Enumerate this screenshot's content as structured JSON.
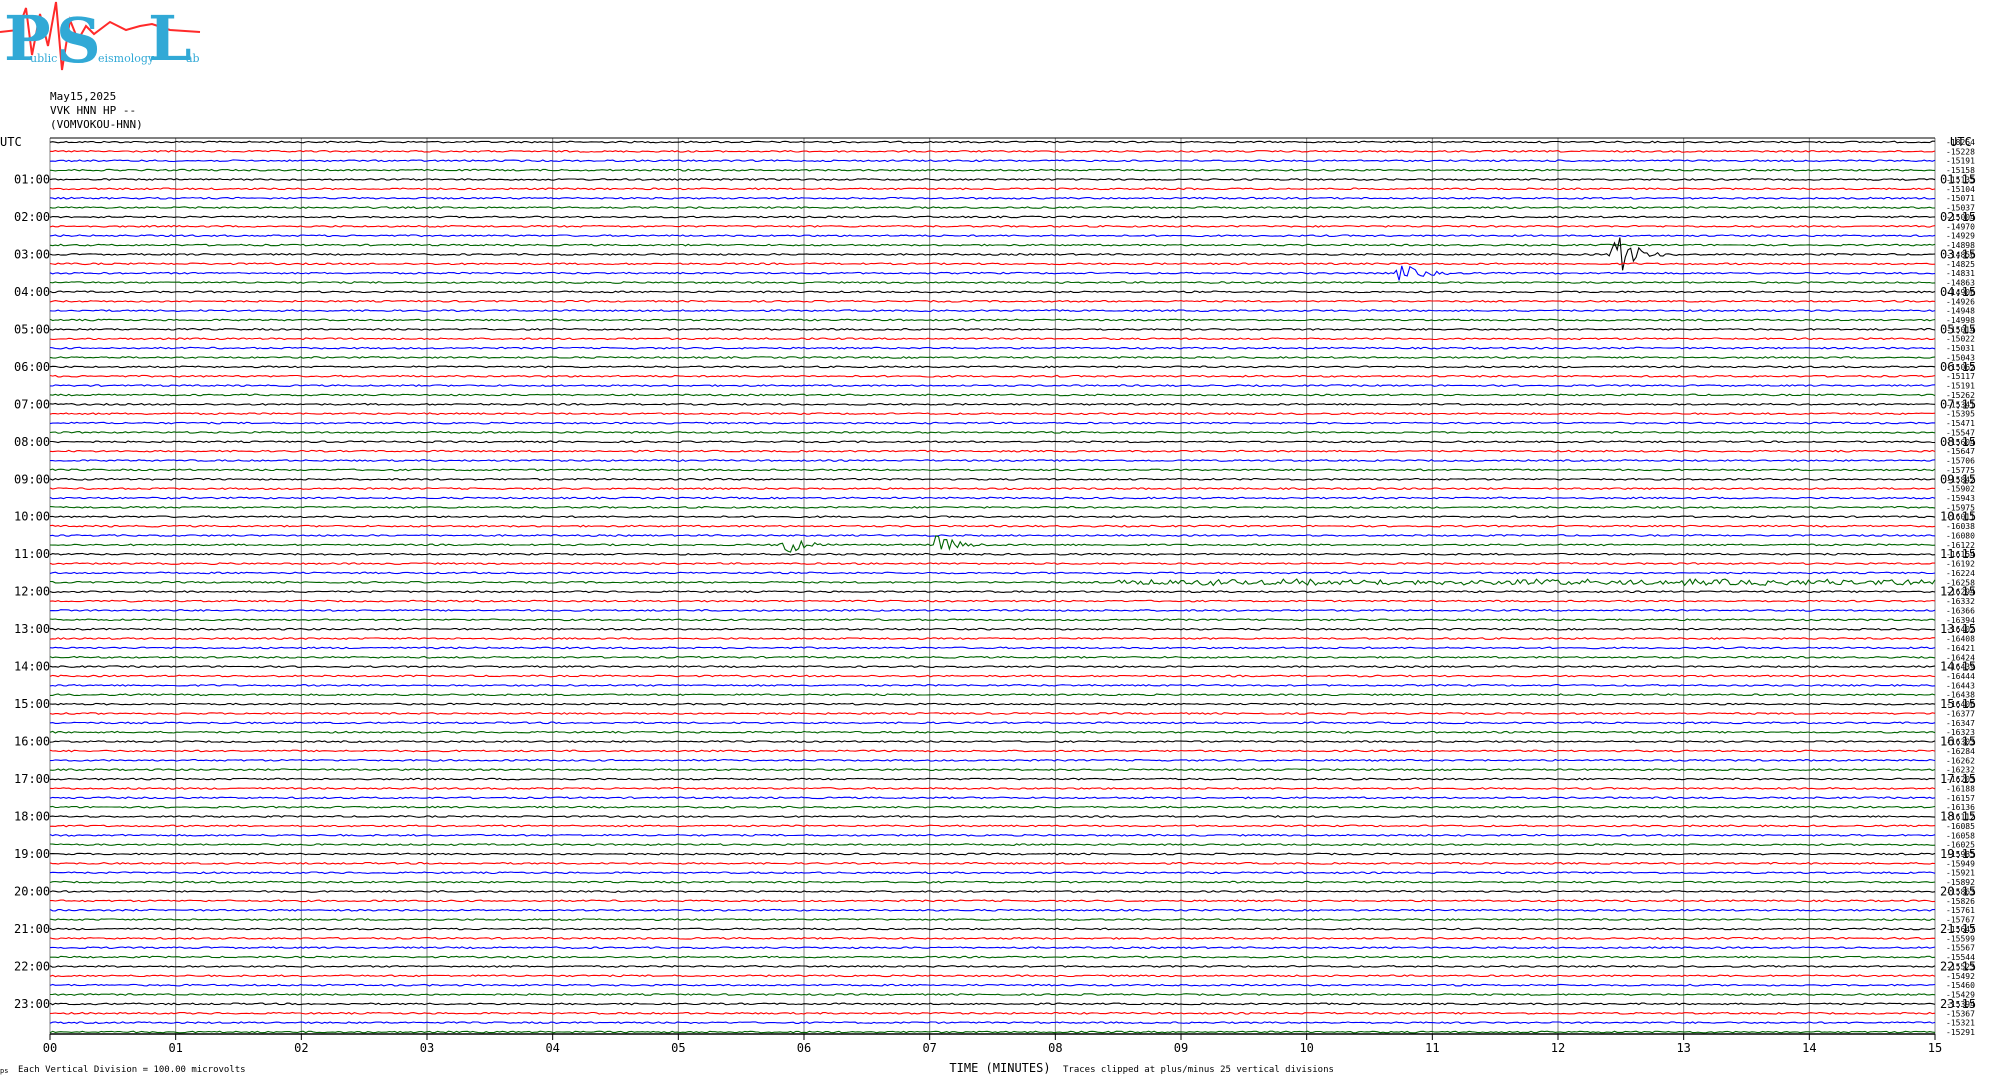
{
  "logo": {
    "letters": [
      "P",
      "S",
      "L"
    ],
    "tagline": [
      "ublic",
      "eismology",
      "ab"
    ]
  },
  "header": {
    "date": "May15,2025",
    "channel": "VVK HNN HP --",
    "station": "(VOMVOKOU-HNN)"
  },
  "left_axis_label": "UTC",
  "right_axis_label": "UTC",
  "footer": {
    "scale_note": "Each Vertical Division =  100.00 microvolts",
    "clip_note": "Traces clipped at plus/minus 25 vertical divisions",
    "corner_mark": "ps"
  },
  "colors": {
    "black": "#000000",
    "red": "#ff0000",
    "blue": "#0000ff",
    "green": "#006400",
    "grid": "#808080",
    "logo": "#31a9d6"
  },
  "chart_data": {
    "type": "line",
    "title": "May15,2025",
    "xlabel": "TIME (MINUTES)",
    "ylabel": "UTC",
    "xlim": [
      0,
      15
    ],
    "x_ticks": [
      "00",
      "01",
      "02",
      "03",
      "04",
      "05",
      "06",
      "07",
      "08",
      "09",
      "10",
      "11",
      "12",
      "13",
      "14",
      "15"
    ],
    "trace_minutes": 15,
    "trace_color_cycle": [
      "black",
      "red",
      "blue",
      "green"
    ],
    "left_hour_labels": [
      "01:00",
      "02:00",
      "03:00",
      "04:00",
      "05:00",
      "06:00",
      "07:00",
      "08:00",
      "09:00",
      "10:00",
      "11:00",
      "12:00",
      "13:00",
      "14:00",
      "15:00",
      "16:00",
      "17:00",
      "18:00",
      "19:00",
      "20:00",
      "21:00",
      "22:00",
      "23:00"
    ],
    "right_hour_labels": [
      "01:15",
      "02:15",
      "03:15",
      "04:15",
      "05:15",
      "06:15",
      "07:15",
      "08:15",
      "09:15",
      "10:15",
      "11:15",
      "12:15",
      "13:15",
      "14:15",
      "15:15",
      "16:15",
      "17:15",
      "18:15",
      "19:15",
      "20:15",
      "21:15",
      "22:15",
      "23:15"
    ],
    "right_offsets": [
      "-18264",
      "-15228",
      "-15191",
      "-15158",
      "-15135",
      "-15104",
      "-15071",
      "-15037",
      "-15004",
      "-14970",
      "-14929",
      "-14898",
      "-14856",
      "-14825",
      "-14831",
      "-14863",
      "-14906",
      "-14926",
      "-14948",
      "-14998",
      "-15014",
      "-15022",
      "-15031",
      "-15043",
      "-15062",
      "-15117",
      "-15191",
      "-15262",
      "-15341",
      "-15395",
      "-15471",
      "-15547",
      "-15604",
      "-15647",
      "-15706",
      "-15775",
      "-15842",
      "-15902",
      "-15943",
      "-15975",
      "-16011",
      "-16038",
      "-16080",
      "-16122",
      "-16154",
      "-16192",
      "-16224",
      "-16258",
      "-16294",
      "-16332",
      "-16366",
      "-16394",
      "-16402",
      "-16408",
      "-16421",
      "-16424",
      "-16439",
      "-16444",
      "-16443",
      "-16438",
      "-16406",
      "-16377",
      "-16347",
      "-16323",
      "-16303",
      "-16284",
      "-16262",
      "-16232",
      "-16203",
      "-16188",
      "-16157",
      "-16136",
      "-16112",
      "-16085",
      "-16058",
      "-16025",
      "-15985",
      "-15949",
      "-15921",
      "-15892",
      "-15863",
      "-15826",
      "-15761",
      "-15767",
      "-15647",
      "-15599",
      "-15567",
      "-15544",
      "-15523",
      "-15492",
      "-15460",
      "-15429",
      "-15394",
      "-15367",
      "-15321",
      "-15291"
    ],
    "events": [
      {
        "trace_row": 12,
        "minute": 12.45,
        "amplitude": "large",
        "label": "03:00 black trace"
      },
      {
        "trace_row": 14,
        "minute": 10.75,
        "amplitude": "medium",
        "label": "03:30 green trace"
      },
      {
        "trace_row": 43,
        "minute": 5.85,
        "amplitude": "medium",
        "label": "10:45 green trace"
      },
      {
        "trace_row": 43,
        "minute": 7.05,
        "amplitude": "medium",
        "label": "10:45 green trace"
      },
      {
        "trace_row": 47,
        "minute": 8.5,
        "amplitude": "noise-band",
        "label": "11:45 green trace"
      }
    ]
  }
}
